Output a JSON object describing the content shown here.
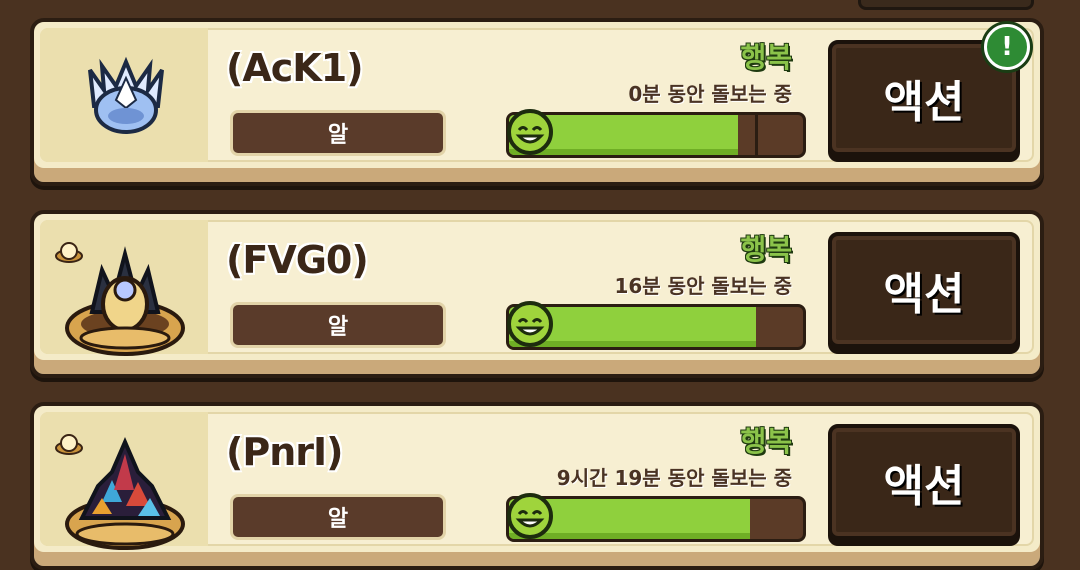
{
  "pets": [
    {
      "name": "(AcK1)",
      "type_label": "알",
      "mood": "행복",
      "care_time": "0분 동안 돌보는 중",
      "happiness": 0.78,
      "action_label": "액션",
      "alert": "!",
      "has_nest": false
    },
    {
      "name": "(FVG0)",
      "type_label": "알",
      "mood": "행복",
      "care_time": "16분 동안 돌보는 중",
      "happiness": 0.84,
      "action_label": "액션",
      "has_nest": true
    },
    {
      "name": "(PnrI)",
      "type_label": "알",
      "mood": "행복",
      "care_time": "9시간 19분 동안 돌보는 중",
      "happiness": 0.82,
      "action_label": "액션",
      "has_nest": true
    }
  ],
  "colors": {
    "happy_green": "#8fd03d",
    "card_bg": "#f4ebc8",
    "button_bg": "#3a2718"
  }
}
